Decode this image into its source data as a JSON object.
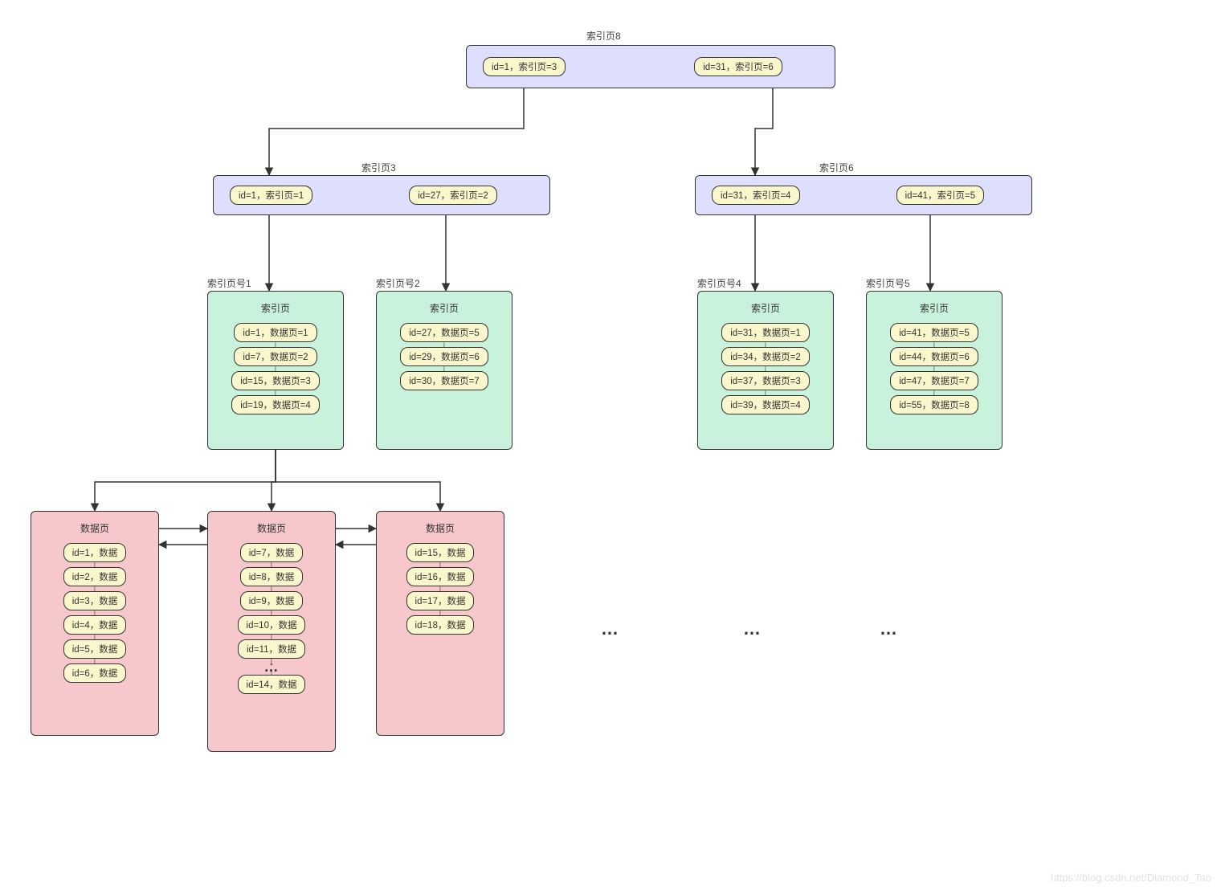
{
  "labels": {
    "root": "索引页8",
    "l1_left": "索引页3",
    "l1_right": "索引页6",
    "leaf1": "索引页号1",
    "leaf2": "索引页号2",
    "leaf4": "索引页号4",
    "leaf5": "索引页号5",
    "leaf_title": "索引页",
    "data_title": "数据页"
  },
  "root_entries": [
    "id=1，索引页=3",
    "id=31，索引页=6"
  ],
  "l1_left_entries": [
    "id=1，索引页=1",
    "id=27，索引页=2"
  ],
  "l1_right_entries": [
    "id=31，索引页=4",
    "id=41，索引页=5"
  ],
  "leaf_left": [
    {
      "items": [
        "id=1，数据页=1",
        "id=7，数据页=2",
        "id=15，数据页=3",
        "id=19，数据页=4"
      ]
    },
    {
      "items": [
        "id=27，数据页=5",
        "id=29，数据页=6",
        "id=30，数据页=7"
      ]
    }
  ],
  "leaf_right": [
    {
      "items": [
        "id=31，数据页=1",
        "id=34，数据页=2",
        "id=37，数据页=3",
        "id=39，数据页=4"
      ]
    },
    {
      "items": [
        "id=41，数据页=5",
        "id=44，数据页=6",
        "id=47，数据页=7",
        "id=55，数据页=8"
      ]
    }
  ],
  "data_pages": [
    {
      "items": [
        "id=1，数据",
        "id=2，数据",
        "id=3，数据",
        "id=4，数据",
        "id=5，数据",
        "id=6，数据"
      ],
      "ellipsis_after": null
    },
    {
      "items": [
        "id=7，数据",
        "id=8，数据",
        "id=9，数据",
        "id=10，数据",
        "id=11，数据",
        "id=14，数据"
      ],
      "ellipsis_after": 4
    },
    {
      "items": [
        "id=15，数据",
        "id=16，数据",
        "id=17，数据",
        "id=18，数据"
      ],
      "ellipsis_after": null
    }
  ],
  "watermark": "https://blog.csdn.net/Diamond_Tao",
  "colors": {
    "purple": "#dedffc",
    "mint": "#c9f2dd",
    "pink": "#f6c8cc",
    "entry": "#faf7cd"
  }
}
